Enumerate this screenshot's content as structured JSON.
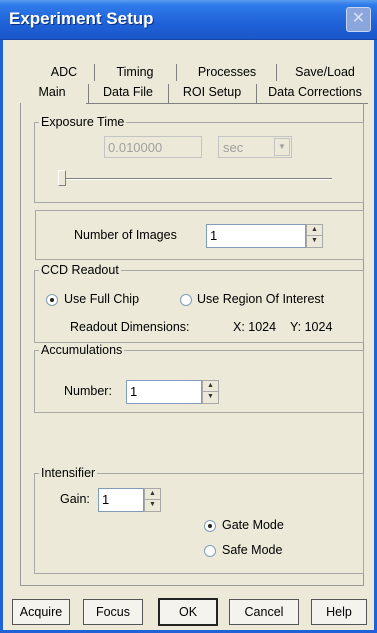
{
  "window": {
    "title": "Experiment Setup",
    "close_glyph": "✕"
  },
  "tabs": {
    "row1": [
      "ADC",
      "Timing",
      "Processes",
      "Save/Load"
    ],
    "row2": [
      "Main",
      "Data File",
      "ROI Setup",
      "Data Corrections"
    ],
    "active": "Main"
  },
  "exposure": {
    "legend": "Exposure Time",
    "value": "0.010000",
    "unit": "sec",
    "slider_value": 0
  },
  "images": {
    "label": "Number of Images",
    "value": "1"
  },
  "ccd": {
    "legend": "CCD Readout",
    "full_chip": "Use Full Chip",
    "roi": "Use Region Of Interest",
    "selected": "full_chip",
    "dims_label": "Readout Dimensions:",
    "x": "X: 1024",
    "y": "Y: 1024"
  },
  "accumulations": {
    "legend": "Accumulations",
    "label": "Number:",
    "value": "1"
  },
  "intensifier": {
    "legend": "Intensifier",
    "gain_label": "Gain:",
    "gain_value": "1",
    "gate_mode": "Gate Mode",
    "safe_mode": "Safe Mode",
    "selected": "gate_mode"
  },
  "buttons": {
    "acquire": "Acquire",
    "focus": "Focus",
    "ok": "OK",
    "cancel": "Cancel",
    "help": "Help"
  }
}
